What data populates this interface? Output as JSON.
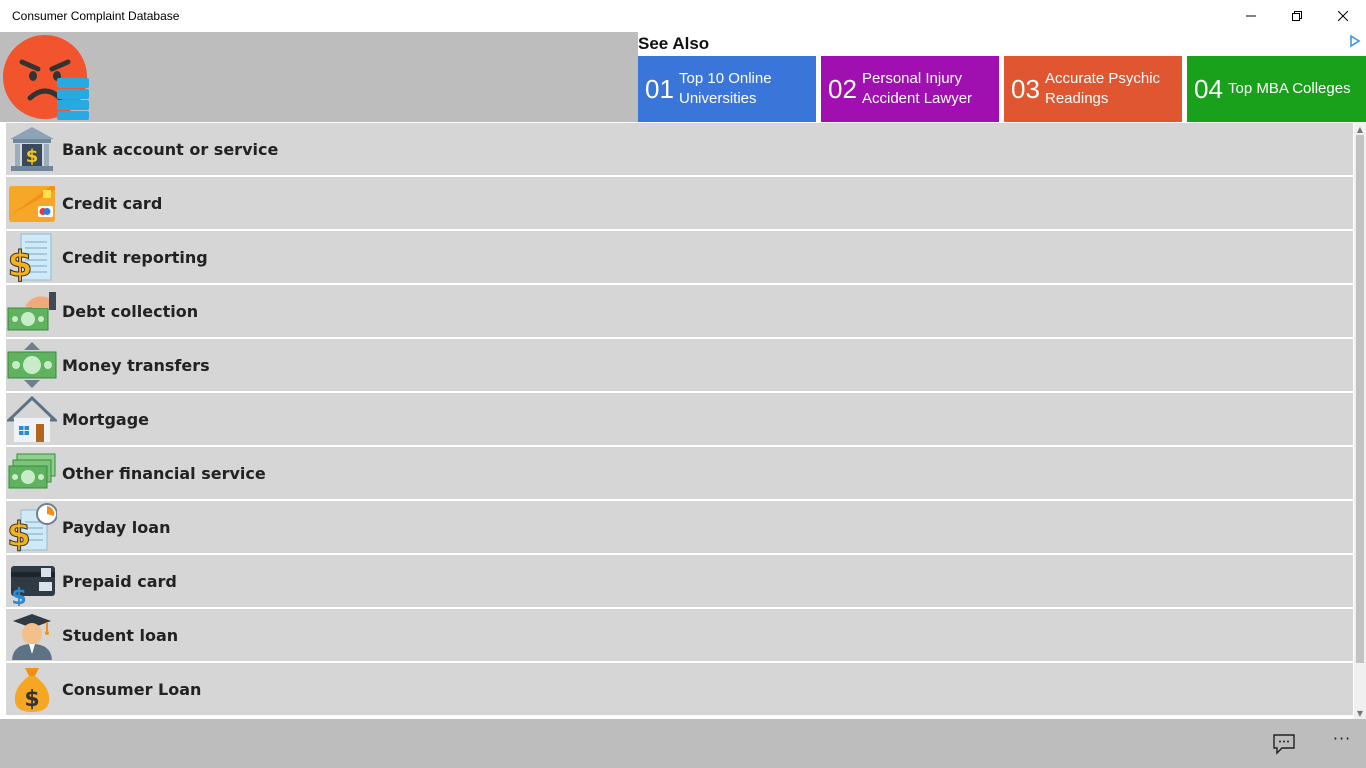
{
  "window": {
    "title": "Consumer Complaint Database"
  },
  "header": {
    "see_also": "See Also",
    "ads": [
      {
        "num": "01",
        "label": "Top 10 Online Universities",
        "color": "#3a75d9"
      },
      {
        "num": "02",
        "label": "Personal Injury Accident Lawyer",
        "color": "#a010b0"
      },
      {
        "num": "03",
        "label": "Accurate Psychic Readings",
        "color": "#df5630"
      },
      {
        "num": "04",
        "label": "Top MBA Colleges",
        "color": "#19a11b"
      }
    ]
  },
  "list": {
    "items": [
      {
        "label": "Bank account or service",
        "icon": "bank-icon"
      },
      {
        "label": "Credit card",
        "icon": "credit-card-icon"
      },
      {
        "label": "Credit reporting",
        "icon": "credit-report-icon"
      },
      {
        "label": "Debt collection",
        "icon": "debt-collection-icon"
      },
      {
        "label": "Money transfers",
        "icon": "money-transfer-icon"
      },
      {
        "label": "Mortgage",
        "icon": "house-icon"
      },
      {
        "label": "Other financial service",
        "icon": "money-stack-icon"
      },
      {
        "label": "Payday loan",
        "icon": "payday-loan-icon"
      },
      {
        "label": "Prepaid card",
        "icon": "prepaid-card-icon"
      },
      {
        "label": "Student loan",
        "icon": "student-icon"
      },
      {
        "label": "Consumer Loan",
        "icon": "money-bag-icon"
      }
    ]
  },
  "bottombar": {
    "more": "···"
  },
  "colors": {
    "header_bg": "#bdbdbd",
    "row_bg": "#d6d6d6",
    "bottombar_bg": "#bdbdbd"
  }
}
